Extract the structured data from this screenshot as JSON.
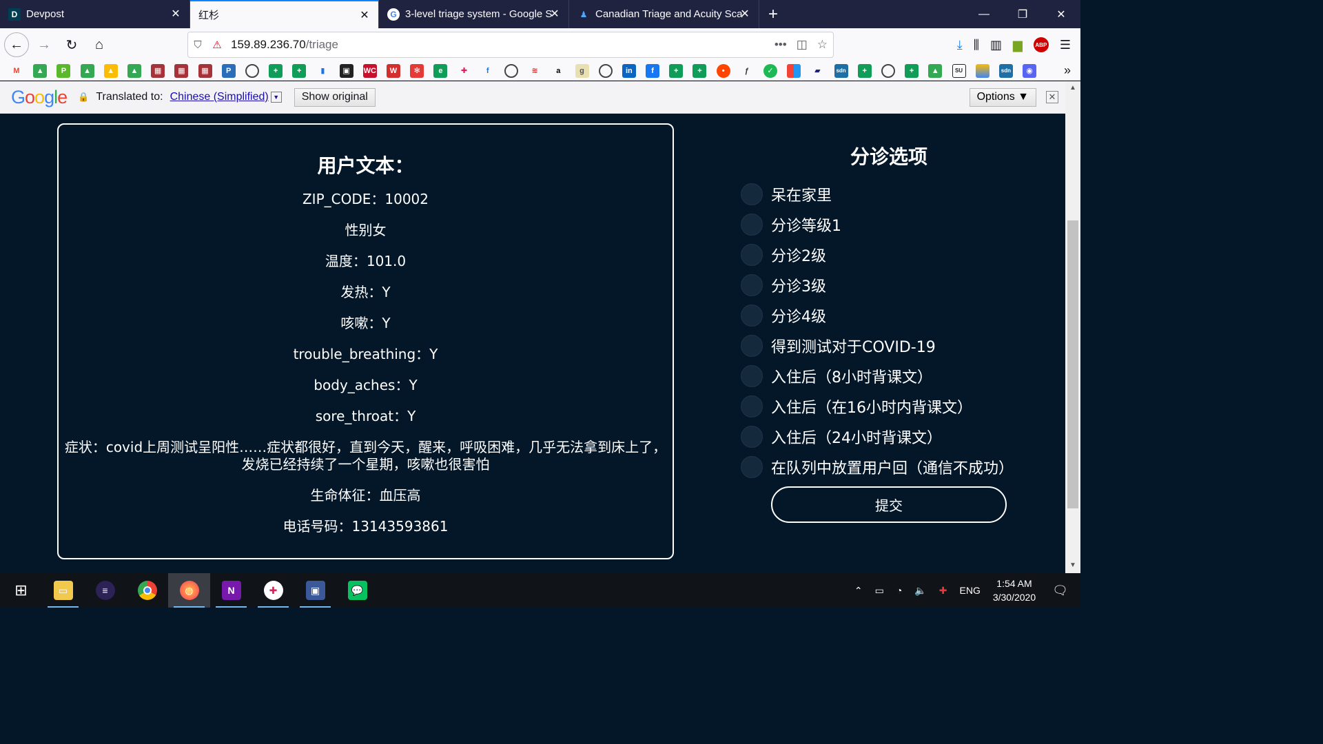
{
  "browser": {
    "tabs": [
      {
        "label": "Devpost",
        "icon": "devpost-icon",
        "active": false
      },
      {
        "label": "红杉",
        "icon": "",
        "active": true
      },
      {
        "label": "3-level triage system - Google S",
        "icon": "google-icon",
        "active": false
      },
      {
        "label": "Canadian Triage and Acuity Sca",
        "icon": "ctas-icon",
        "active": false
      }
    ],
    "url_host": "159.89.236.70",
    "url_path": "/triage"
  },
  "translate_bar": {
    "label": "Translated to:",
    "language": "Chinese (Simplified)",
    "show_original": "Show original",
    "options": "Options ▼"
  },
  "user_card": {
    "title": "用户文本：",
    "zip": "ZIP_CODE：10002",
    "gender": "性别女",
    "temperature": "温度：101.0",
    "fever": "发热：Y",
    "cough": "咳嗽：Y",
    "trouble_breathing": "trouble_breathing：Y",
    "body_aches": "body_aches：Y",
    "sore_throat": "sore_throat：Y",
    "symptoms": "症状：covid上周测试呈阳性……症状都很好，直到今天，醒来，呼吸困难，几乎无法拿到床上了，发烧已经持续了一个星期，咳嗽也很害怕",
    "vitals": "生命体征：血压高",
    "phone": "电话号码：13143593861"
  },
  "triage": {
    "title": "分诊选项",
    "options": [
      "呆在家里",
      "分诊等级1",
      "分诊2级",
      "分诊3级",
      "分诊4级",
      "得到测试对于COVID-19",
      "入住后（8小时背课文）",
      "入住后（在16小时内背课文）",
      "入住后（24小时背课文）",
      "在队列中放置用户回（通信不成功）"
    ],
    "submit": "提交"
  },
  "taskbar": {
    "language": "ENG",
    "time": "1:54 AM",
    "date": "3/30/2020"
  },
  "colors": {
    "page_bg": "#041729",
    "tabstrip_bg": "#202340",
    "accent": "#0a84ff"
  }
}
